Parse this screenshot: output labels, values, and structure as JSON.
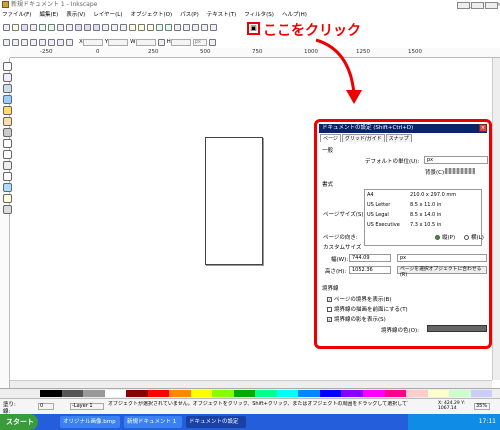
{
  "window": {
    "title": "新規ドキュメント 1 - Inkscape",
    "controls": [
      "_",
      "□",
      "×"
    ]
  },
  "menu": [
    "ファイル(F)",
    "編集(E)",
    "表示(V)",
    "レイヤー(L)",
    "オブジェクト(O)",
    "パス(P)",
    "テキスト(T)",
    "フィルタ(S)",
    "ヘルプ(H)"
  ],
  "toolbar2": {
    "x": "X",
    "y": "Y",
    "w": "W",
    "h": "H",
    "unit": "px"
  },
  "ruler": {
    "ticks": [
      "-250",
      "0",
      "250",
      "500",
      "750",
      "1000",
      "1250",
      "1500"
    ]
  },
  "callout": {
    "icon": "▣",
    "text": "ここをクリック"
  },
  "dialog": {
    "title": "ドキュメントの設定 (Shift+Ctrl+D)",
    "tabs": [
      "ページ",
      "グリッド/ガイド",
      "スナップ"
    ],
    "general_label": "一般",
    "default_unit_label": "デフォルトの単位(U):",
    "default_unit_value": "px",
    "background_label": "背景(C):",
    "format_label": "書式",
    "page_size_label": "ページサイズ(S):",
    "sizes": [
      {
        "name": "A4",
        "dim": "210.0 x 297.0 mm"
      },
      {
        "name": "US Letter",
        "dim": "8.5 x 11.0 in"
      },
      {
        "name": "US Legal",
        "dim": "8.5 x 14.0 in"
      },
      {
        "name": "US Executive",
        "dim": "7.3 x 10.5 in"
      }
    ],
    "orientation_label": "ページの向き:",
    "portrait": "縦(P)",
    "landscape": "横(L)",
    "custom_label": "カスタムサイズ",
    "width_label": "幅(W):",
    "width_value": "744.09",
    "height_label": "高さ(H):",
    "height_value": "1052.36",
    "custom_unit": "px",
    "fit_button": "ページを選択オブジェクトに合わせる(R)",
    "border_label": "境界線",
    "show_border": "ページの境界を表示(B)",
    "border_top": "境界線の描画を前面にする(T)",
    "show_shadow": "境界線の影を表示(S)",
    "border_color_label": "境界線の色(O):"
  },
  "status": {
    "fill": "塗り:",
    "stroke": "線:",
    "opacity": "0",
    "layer": "-Layer 1",
    "message": "オブジェクトが選択されていません。オブジェクトをクリック、Shift+クリック、またはオブジェクトの周囲をドラッグして選択して下さい。",
    "coords": "X: 424.29 Y: 1067.14",
    "zoom": "35%"
  },
  "taskbar": {
    "start": "スタート",
    "tasks": [
      "オリジナル画像.bmp",
      "新規ドキュメント 1",
      "ドキュメントの設定"
    ],
    "time": "17:11"
  },
  "colors": {
    "accent": "#ee0000",
    "titlebar": "#0a246a",
    "taskbar": "#245edb"
  }
}
